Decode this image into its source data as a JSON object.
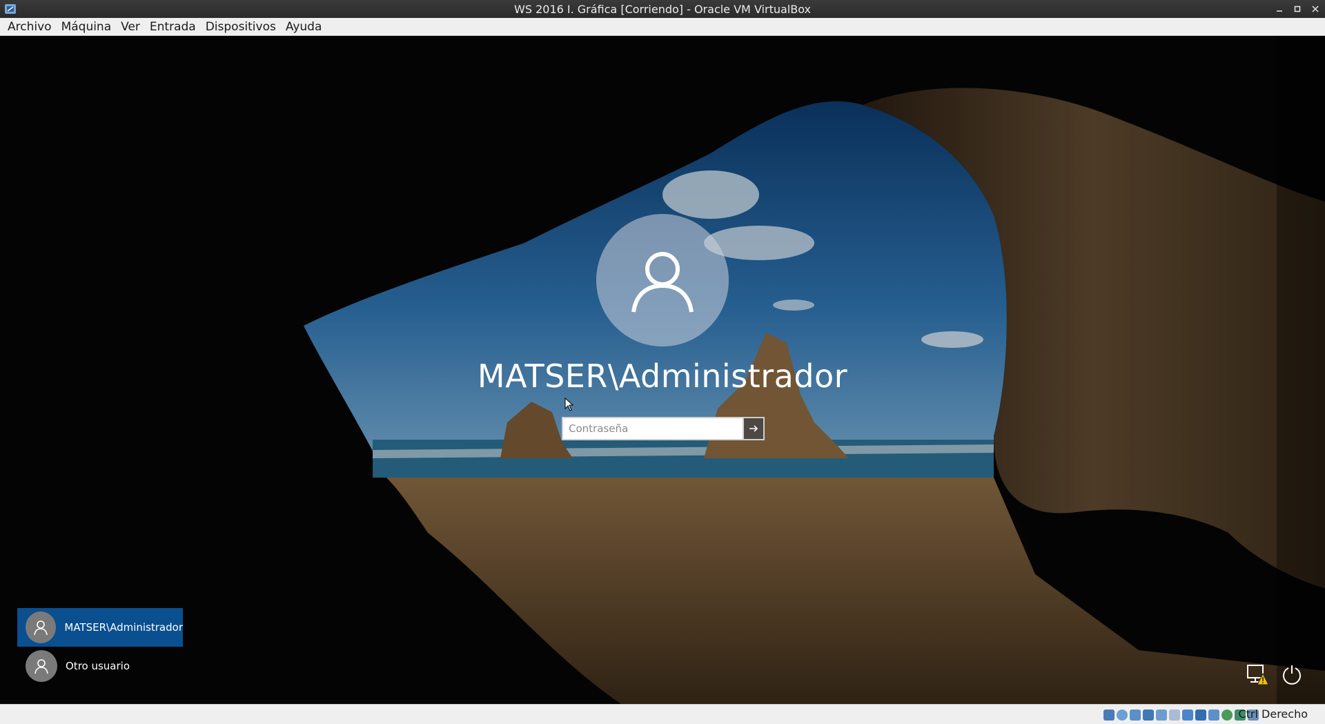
{
  "window": {
    "title": "WS 2016 I. Gráfica [Corriendo] - Oracle VM VirtualBox",
    "controls": {
      "minimize": "–",
      "maximize": "□",
      "close": "✕"
    }
  },
  "menu": {
    "items": [
      "Archivo",
      "Máquina",
      "Ver",
      "Entrada",
      "Dispositivos",
      "Ayuda"
    ]
  },
  "login": {
    "username": "MATSER\\Administrador",
    "password_placeholder": "Contraseña",
    "password_value": ""
  },
  "users": [
    {
      "name": "MATSER\\Administrador",
      "selected": true
    },
    {
      "name": "Otro usuario",
      "selected": false
    }
  ],
  "corner_icons": [
    "network-warning-icon",
    "power-icon"
  ],
  "statusbar": {
    "host_key": "Ctrl Derecho",
    "icons": [
      "hard-disk-icon",
      "optical-drive-icon",
      "audio-icon",
      "network-icon",
      "usb-icon",
      "shared-folders-icon",
      "display-icon",
      "video-capture-icon",
      "cpu-icon",
      "virtualization-icon",
      "mouse-integration-icon",
      "keyboard-icon"
    ]
  },
  "colors": {
    "selected_user": "#0a4f8f",
    "titlebar": "#2e2e2e",
    "menubar": "#efefef"
  }
}
